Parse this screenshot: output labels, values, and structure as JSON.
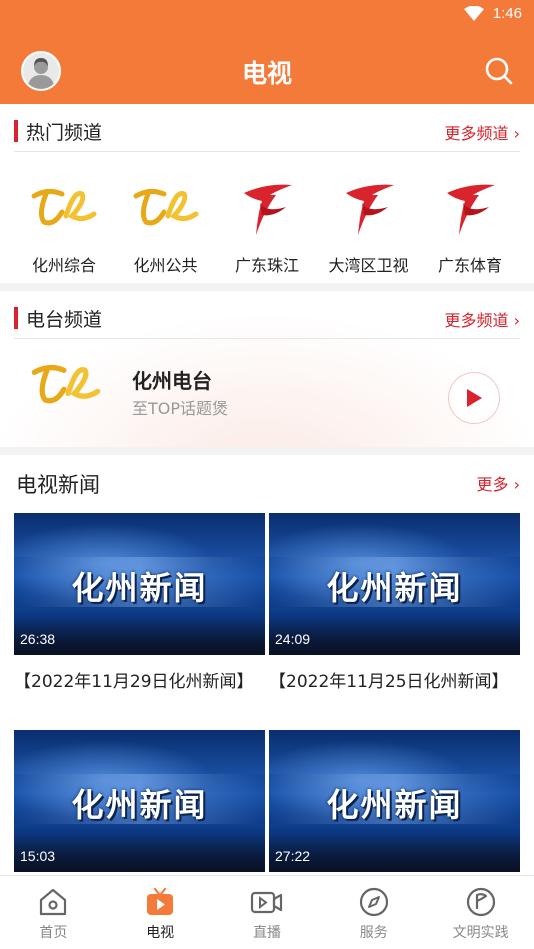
{
  "status": {
    "time": "1:46"
  },
  "header": {
    "title": "电视"
  },
  "hot": {
    "title": "热门频道",
    "more": "更多频道 ›",
    "channels": [
      {
        "label": "化州综合",
        "icon": "huazhou-tv-logo"
      },
      {
        "label": "化州公共",
        "icon": "huazhou-tv-logo"
      },
      {
        "label": "广东珠江",
        "icon": "guangdong-tv-logo"
      },
      {
        "label": "大湾区卫视",
        "icon": "guangdong-tv-logo"
      },
      {
        "label": "广东体育",
        "icon": "guangdong-tv-logo"
      }
    ]
  },
  "radio": {
    "title": "电台频道",
    "more": "更多频道 ›",
    "name": "化州电台",
    "subtitle": "至TOP话题煲"
  },
  "news": {
    "title": "电视新闻",
    "more": "更多 ›",
    "items": [
      {
        "caption": "化州新闻",
        "duration": "26:38",
        "title": "【2022年11月29日化州新闻】"
      },
      {
        "caption": "化州新闻",
        "duration": "24:09",
        "title": "【2022年11月25日化州新闻】"
      },
      {
        "caption": "化州新闻",
        "duration": "15:03",
        "title": ""
      },
      {
        "caption": "化州新闻",
        "duration": "27:22",
        "title": ""
      }
    ]
  },
  "tabs": [
    {
      "label": "首页",
      "icon": "home-icon"
    },
    {
      "label": "电视",
      "icon": "tv-icon"
    },
    {
      "label": "直播",
      "icon": "live-video-icon"
    },
    {
      "label": "服务",
      "icon": "compass-icon"
    },
    {
      "label": "文明实践",
      "icon": "flag-badge-icon"
    }
  ],
  "colors": {
    "header": "#f47a3a",
    "accent": "#d9232d",
    "active_tab": "#f47a3a"
  }
}
